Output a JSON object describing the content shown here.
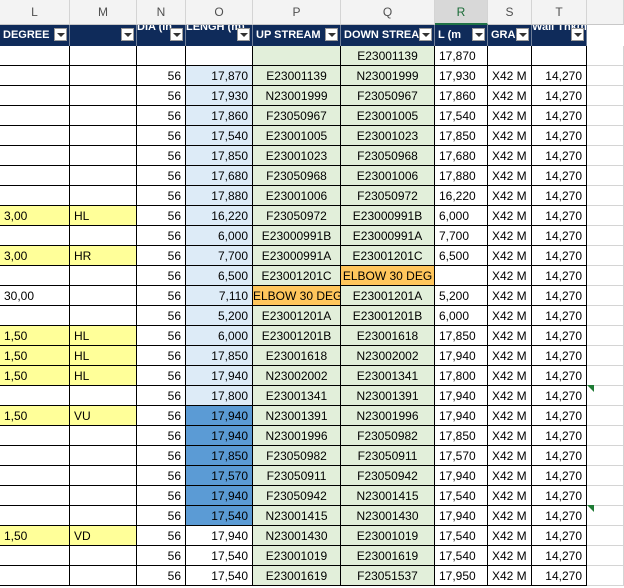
{
  "columns": [
    "L",
    "M",
    "N",
    "O",
    "P",
    "Q",
    "R",
    "S",
    "T"
  ],
  "selected_column": "R",
  "headers": [
    {
      "text": "DEGREE",
      "two": false
    },
    {
      "text": "",
      "two": false
    },
    {
      "text": "DIA (In",
      "two": true
    },
    {
      "text": "LENGH (m)",
      "two": true
    },
    {
      "text": "UP STREAM",
      "two": false
    },
    {
      "text": "DOWN STREA",
      "two": false
    },
    {
      "text": "L (m",
      "two": false
    },
    {
      "text": "GRA",
      "two": false
    },
    {
      "text": "Wall Thk(mm",
      "two": true
    }
  ],
  "rows": [
    {
      "deg": "",
      "mark": "",
      "dia": "",
      "len": "",
      "up": "",
      "down": "E23001139",
      "l": "17,870",
      "gr": "",
      "wall": "",
      "bgLen": "",
      "bgUp": "green",
      "bgDown": "green",
      "yl": false
    },
    {
      "deg": "",
      "mark": "",
      "dia": "56",
      "len": "17,870",
      "up": "E23001139",
      "down": "N23001999",
      "l": "17,930",
      "gr": "X42 M",
      "wall": "14,270",
      "bgLen": "blue",
      "bgUp": "green",
      "bgDown": "green",
      "yl": false
    },
    {
      "deg": "",
      "mark": "",
      "dia": "56",
      "len": "17,930",
      "up": "N23001999",
      "down": "F23050967",
      "l": "17,860",
      "gr": "X42 M",
      "wall": "14,270",
      "bgLen": "blue",
      "bgUp": "green",
      "bgDown": "green",
      "yl": false
    },
    {
      "deg": "",
      "mark": "",
      "dia": "56",
      "len": "17,860",
      "up": "F23050967",
      "down": "E23001005",
      "l": "17,540",
      "gr": "X42 M",
      "wall": "14,270",
      "bgLen": "blue",
      "bgUp": "green",
      "bgDown": "green",
      "yl": false
    },
    {
      "deg": "",
      "mark": "",
      "dia": "56",
      "len": "17,540",
      "up": "E23001005",
      "down": "E23001023",
      "l": "17,850",
      "gr": "X42 M",
      "wall": "14,270",
      "bgLen": "blue",
      "bgUp": "green",
      "bgDown": "green",
      "yl": false
    },
    {
      "deg": "",
      "mark": "",
      "dia": "56",
      "len": "17,850",
      "up": "E23001023",
      "down": "F23050968",
      "l": "17,680",
      "gr": "X42 M",
      "wall": "14,270",
      "bgLen": "blue",
      "bgUp": "green",
      "bgDown": "green",
      "yl": false
    },
    {
      "deg": "",
      "mark": "",
      "dia": "56",
      "len": "17,680",
      "up": "F23050968",
      "down": "E23001006",
      "l": "17,880",
      "gr": "X42 M",
      "wall": "14,270",
      "bgLen": "blue",
      "bgUp": "green",
      "bgDown": "green",
      "yl": false
    },
    {
      "deg": "",
      "mark": "",
      "dia": "56",
      "len": "17,880",
      "up": "E23001006",
      "down": "F23050972",
      "l": "16,220",
      "gr": "X42 M",
      "wall": "14,270",
      "bgLen": "blue",
      "bgUp": "green",
      "bgDown": "green",
      "yl": false
    },
    {
      "deg": "3,00",
      "mark": "HL",
      "dia": "56",
      "len": "16,220",
      "up": "F23050972",
      "down": "E23000991B",
      "l": "6,000",
      "gr": "X42 M",
      "wall": "14,270",
      "bgLen": "blue",
      "bgUp": "green",
      "bgDown": "green",
      "yl": true
    },
    {
      "deg": "",
      "mark": "",
      "dia": "56",
      "len": "6,000",
      "up": "E23000991B",
      "down": "E23000991A",
      "l": "7,700",
      "gr": "X42 M",
      "wall": "14,270",
      "bgLen": "blue",
      "bgUp": "green",
      "bgDown": "green",
      "yl": false
    },
    {
      "deg": "3,00",
      "mark": "HR",
      "dia": "56",
      "len": "7,700",
      "up": "E23000991A",
      "down": "E23001201C",
      "l": "6,500",
      "gr": "X42 M",
      "wall": "14,270",
      "bgLen": "blue",
      "bgUp": "green",
      "bgDown": "green",
      "yl": true
    },
    {
      "deg": "",
      "mark": "",
      "dia": "56",
      "len": "6,500",
      "up": "E23001201C",
      "down": "ELBOW 30 DEG",
      "l": "",
      "gr": "X42 M",
      "wall": "14,270",
      "bgLen": "blue",
      "bgUp": "green",
      "bgDown": "orange",
      "yl": false
    },
    {
      "deg": "30,00",
      "mark": "",
      "dia": "56",
      "len": "7,110",
      "up": "ELBOW 30 DEG",
      "down": "E23001201A",
      "l": "5,200",
      "gr": "X42 M",
      "wall": "14,270",
      "bgLen": "blue",
      "bgUp": "orange",
      "bgDown": "green",
      "yl": false
    },
    {
      "deg": "",
      "mark": "",
      "dia": "56",
      "len": "5,200",
      "up": "E23001201A",
      "down": "E23001201B",
      "l": "6,000",
      "gr": "X42 M",
      "wall": "14,270",
      "bgLen": "blue",
      "bgUp": "green",
      "bgDown": "green",
      "yl": false
    },
    {
      "deg": "1,50",
      "mark": "HL",
      "dia": "56",
      "len": "6,000",
      "up": "E23001201B",
      "down": "E23001618",
      "l": "17,850",
      "gr": "X42 M",
      "wall": "14,270",
      "bgLen": "blue",
      "bgUp": "green",
      "bgDown": "green",
      "yl": true
    },
    {
      "deg": "1,50",
      "mark": "HL",
      "dia": "56",
      "len": "17,850",
      "up": "E23001618",
      "down": "N23002002",
      "l": "17,940",
      "gr": "X42 M",
      "wall": "14,270",
      "bgLen": "blue",
      "bgUp": "green",
      "bgDown": "green",
      "yl": true
    },
    {
      "deg": "1,50",
      "mark": "HL",
      "dia": "56",
      "len": "17,940",
      "up": "N23002002",
      "down": "E23001341",
      "l": "17,800",
      "gr": "X42 M",
      "wall": "14,270",
      "bgLen": "blue",
      "bgUp": "green",
      "bgDown": "green",
      "yl": true
    },
    {
      "deg": "",
      "mark": "",
      "dia": "56",
      "len": "17,800",
      "up": "E23001341",
      "down": "N23001391",
      "l": "17,940",
      "gr": "X42 M",
      "wall": "14,270",
      "bgLen": "blue",
      "bgUp": "green",
      "bgDown": "green",
      "yl": false
    },
    {
      "deg": "1,50",
      "mark": "VU",
      "dia": "56",
      "len": "17,940",
      "up": "N23001391",
      "down": "N23001996",
      "l": "17,940",
      "gr": "X42 M",
      "wall": "14,270",
      "bgLen": "blueDark",
      "bgUp": "green",
      "bgDown": "green",
      "yl": true
    },
    {
      "deg": "",
      "mark": "",
      "dia": "56",
      "len": "17,940",
      "up": "N23001996",
      "down": "F23050982",
      "l": "17,850",
      "gr": "X42 M",
      "wall": "14,270",
      "bgLen": "blueDark",
      "bgUp": "green",
      "bgDown": "green",
      "yl": false
    },
    {
      "deg": "",
      "mark": "",
      "dia": "56",
      "len": "17,850",
      "up": "F23050982",
      "down": "F23050911",
      "l": "17,570",
      "gr": "X42 M",
      "wall": "14,270",
      "bgLen": "blueDark",
      "bgUp": "green",
      "bgDown": "green",
      "yl": false
    },
    {
      "deg": "",
      "mark": "",
      "dia": "56",
      "len": "17,570",
      "up": "F23050911",
      "down": "F23050942",
      "l": "17,940",
      "gr": "X42 M",
      "wall": "14,270",
      "bgLen": "blueDark",
      "bgUp": "green",
      "bgDown": "green",
      "yl": false
    },
    {
      "deg": "",
      "mark": "",
      "dia": "56",
      "len": "17,940",
      "up": "F23050942",
      "down": "N23001415",
      "l": "17,540",
      "gr": "X42 M",
      "wall": "14,270",
      "bgLen": "blueDark",
      "bgUp": "green",
      "bgDown": "green",
      "yl": false
    },
    {
      "deg": "",
      "mark": "",
      "dia": "56",
      "len": "17,540",
      "up": "N23001415",
      "down": "N23001430",
      "l": "17,940",
      "gr": "X42 M",
      "wall": "14,270",
      "bgLen": "blueDark",
      "bgUp": "green",
      "bgDown": "green",
      "yl": false
    },
    {
      "deg": "1,50",
      "mark": "VD",
      "dia": "56",
      "len": "17,940",
      "up": "N23001430",
      "down": "E23001019",
      "l": "17,540",
      "gr": "X42 M",
      "wall": "14,270",
      "bgLen": "",
      "bgUp": "green",
      "bgDown": "green",
      "yl": true
    },
    {
      "deg": "",
      "mark": "",
      "dia": "56",
      "len": "17,540",
      "up": "E23001019",
      "down": "E23001619",
      "l": "17,540",
      "gr": "X42 M",
      "wall": "14,270",
      "bgLen": "",
      "bgUp": "green",
      "bgDown": "green",
      "yl": false
    },
    {
      "deg": "",
      "mark": "",
      "dia": "56",
      "len": "17,540",
      "up": "E23001619",
      "down": "F23051537",
      "l": "17,950",
      "gr": "X42 M",
      "wall": "14,270",
      "bgLen": "",
      "bgUp": "green",
      "bgDown": "green",
      "yl": false
    }
  ]
}
